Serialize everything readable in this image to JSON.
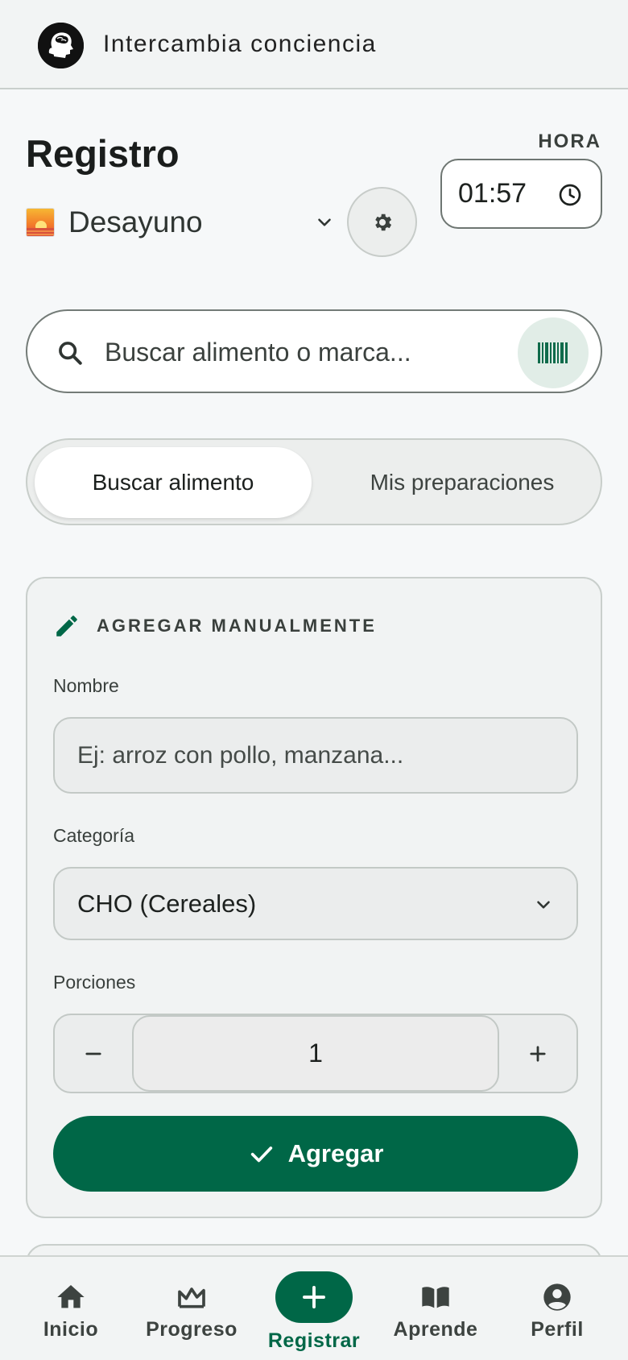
{
  "header": {
    "app_title": "Intercambia conciencia",
    "logo_icon": "brain-head-logo"
  },
  "registro": {
    "title": "Registro",
    "meal": {
      "emoji_icon": "sunrise-icon",
      "name": "Desayuno"
    },
    "hora_label": "HORA",
    "time_value": "01:57"
  },
  "search": {
    "placeholder": "Buscar alimento o marca..."
  },
  "tabs": [
    {
      "label": "Buscar alimento",
      "active": true
    },
    {
      "label": "Mis preparaciones",
      "active": false
    }
  ],
  "manual": {
    "title": "AGREGAR MANUALMENTE",
    "name_label": "Nombre",
    "name_placeholder": "Ej: arroz con pollo, manzana...",
    "category_label": "Categoría",
    "category_value": "CHO (Cereales)",
    "portions_label": "Porciones",
    "portions_value": "1",
    "add_label": "Agregar"
  },
  "nav": [
    {
      "label": "Inicio",
      "icon": "home-icon"
    },
    {
      "label": "Progreso",
      "icon": "chart-icon"
    },
    {
      "label": "Registrar",
      "icon": "plus-icon",
      "active": true
    },
    {
      "label": "Aprende",
      "icon": "book-icon"
    },
    {
      "label": "Perfil",
      "icon": "account-icon"
    }
  ],
  "colors": {
    "primary": "#006747",
    "background": "#f6f8f9",
    "surface": "#f1f3f3"
  }
}
